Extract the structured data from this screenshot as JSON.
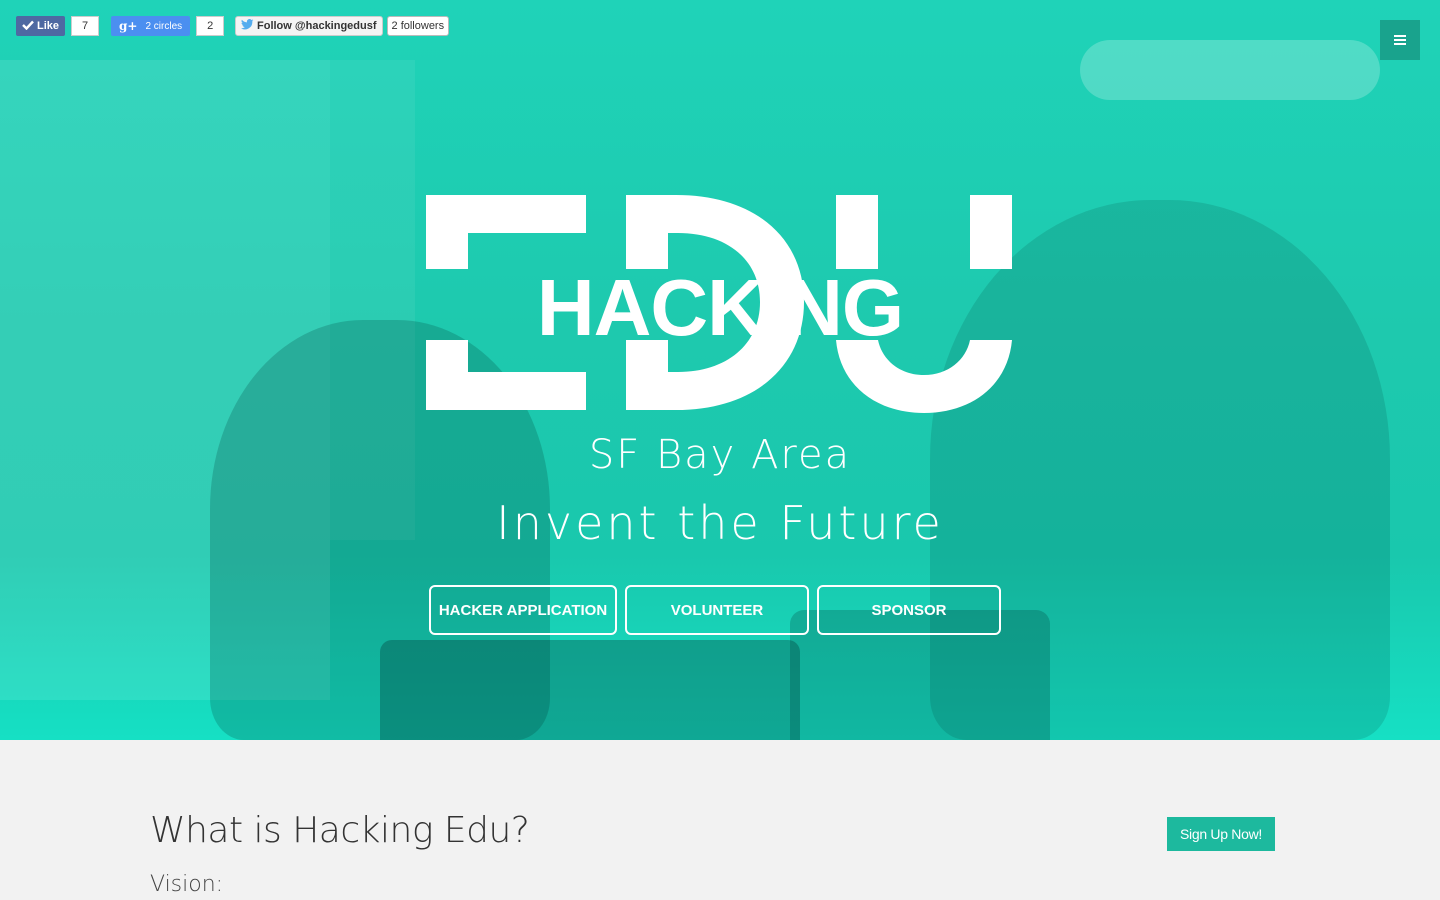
{
  "social": {
    "facebook": {
      "label": "Like",
      "count": "7",
      "icon": "check-icon"
    },
    "google_plus": {
      "label": "2 circles",
      "count": "2",
      "icon": "google-plus-icon"
    },
    "twitter": {
      "label": "Follow @hackingedusf",
      "followers": "2 followers",
      "icon": "twitter-bird-icon"
    }
  },
  "menu": {
    "icon": "hamburger-menu-icon"
  },
  "hero": {
    "logo_big": "EDU",
    "logo_word": "HACKING",
    "location": "SF Bay Area",
    "tagline": "Invent the Future",
    "buttons": [
      "HACKER APPLICATION",
      "VOLUNTEER",
      "SPONSOR"
    ],
    "overlay_color": "#1ecfb5"
  },
  "about": {
    "title": "What is Hacking Edu?",
    "vision_label": "Vision:",
    "signup_label": "Sign Up Now!",
    "accent_color": "#1db99e"
  }
}
